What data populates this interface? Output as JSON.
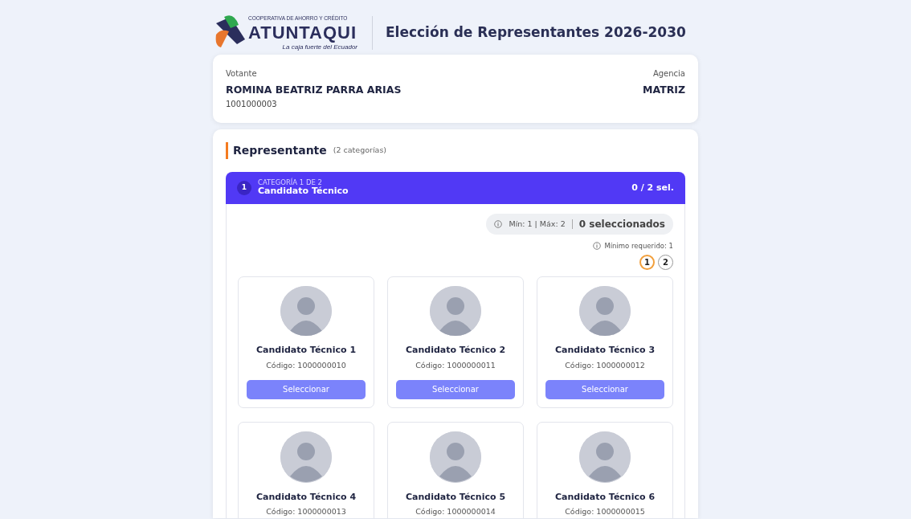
{
  "header": {
    "logo": {
      "tagline_top": "COOPERATIVA DE AHORRO Y CRÉDITO",
      "name": "ATUNTAQUI",
      "slogan": "La caja fuerte del Ecuador"
    },
    "title": "Elección de Representantes 2026-2030"
  },
  "voter": {
    "label": "Votante",
    "name": "ROMINA BEATRIZ PARRA ARIAS",
    "id": "1001000003",
    "agency_label": "Agencia",
    "agency": "MATRIZ"
  },
  "section": {
    "title": "Representante",
    "subtitle": "(2 categorías)"
  },
  "category": {
    "number": "1",
    "overline": "CATEGORÍA 1 DE 2",
    "name": "Candidato Técnico",
    "count": "0 / 2 sel.",
    "limits": "Mín: 1 | Máx: 2",
    "selected_count": "0 seleccionados",
    "minimum_note": "Mínimo requerido: 1",
    "steps": [
      {
        "label": "1",
        "selected": true
      },
      {
        "label": "2",
        "selected": false
      }
    ],
    "candidates": [
      {
        "name": "Candidato Técnico 1",
        "code": "Código: 1000000010",
        "button": "Seleccionar"
      },
      {
        "name": "Candidato Técnico 2",
        "code": "Código: 1000000011",
        "button": "Seleccionar"
      },
      {
        "name": "Candidato Técnico 3",
        "code": "Código: 1000000012",
        "button": "Seleccionar"
      },
      {
        "name": "Candidato Técnico 4",
        "code": "Código: 1000000013"
      },
      {
        "name": "Candidato Técnico 5",
        "code": "Código: 1000000014"
      },
      {
        "name": "Candidato Técnico 6",
        "code": "Código: 1000000015"
      }
    ]
  }
}
